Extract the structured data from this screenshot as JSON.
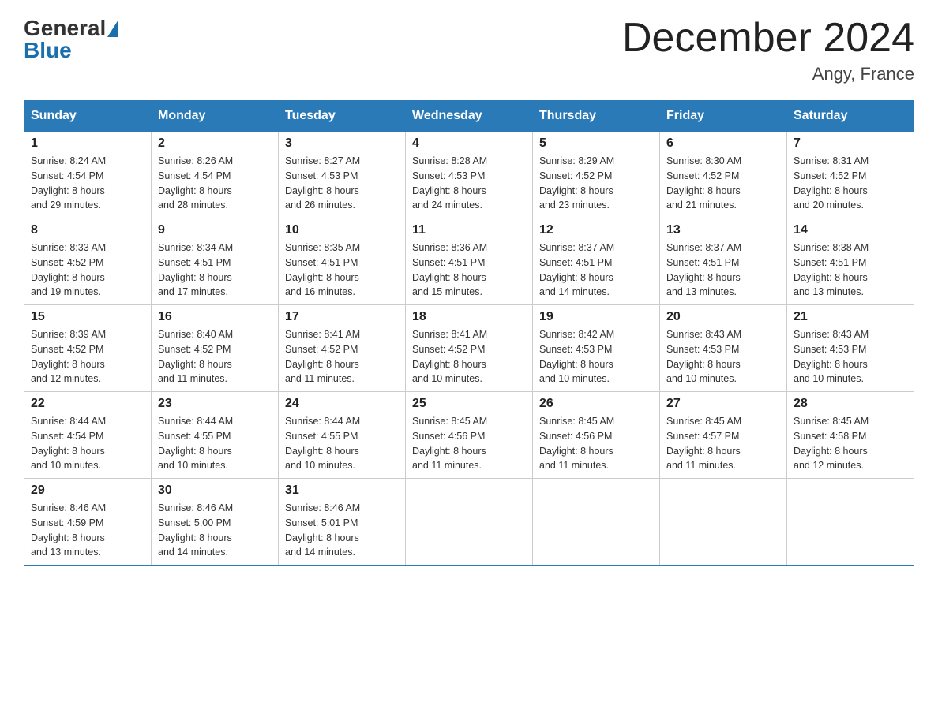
{
  "header": {
    "logo_general": "General",
    "logo_blue": "Blue",
    "month_title": "December 2024",
    "location": "Angy, France"
  },
  "days_of_week": [
    "Sunday",
    "Monday",
    "Tuesday",
    "Wednesday",
    "Thursday",
    "Friday",
    "Saturday"
  ],
  "weeks": [
    [
      {
        "day": "1",
        "sunrise": "Sunrise: 8:24 AM",
        "sunset": "Sunset: 4:54 PM",
        "daylight": "Daylight: 8 hours",
        "daylight2": "and 29 minutes."
      },
      {
        "day": "2",
        "sunrise": "Sunrise: 8:26 AM",
        "sunset": "Sunset: 4:54 PM",
        "daylight": "Daylight: 8 hours",
        "daylight2": "and 28 minutes."
      },
      {
        "day": "3",
        "sunrise": "Sunrise: 8:27 AM",
        "sunset": "Sunset: 4:53 PM",
        "daylight": "Daylight: 8 hours",
        "daylight2": "and 26 minutes."
      },
      {
        "day": "4",
        "sunrise": "Sunrise: 8:28 AM",
        "sunset": "Sunset: 4:53 PM",
        "daylight": "Daylight: 8 hours",
        "daylight2": "and 24 minutes."
      },
      {
        "day": "5",
        "sunrise": "Sunrise: 8:29 AM",
        "sunset": "Sunset: 4:52 PM",
        "daylight": "Daylight: 8 hours",
        "daylight2": "and 23 minutes."
      },
      {
        "day": "6",
        "sunrise": "Sunrise: 8:30 AM",
        "sunset": "Sunset: 4:52 PM",
        "daylight": "Daylight: 8 hours",
        "daylight2": "and 21 minutes."
      },
      {
        "day": "7",
        "sunrise": "Sunrise: 8:31 AM",
        "sunset": "Sunset: 4:52 PM",
        "daylight": "Daylight: 8 hours",
        "daylight2": "and 20 minutes."
      }
    ],
    [
      {
        "day": "8",
        "sunrise": "Sunrise: 8:33 AM",
        "sunset": "Sunset: 4:52 PM",
        "daylight": "Daylight: 8 hours",
        "daylight2": "and 19 minutes."
      },
      {
        "day": "9",
        "sunrise": "Sunrise: 8:34 AM",
        "sunset": "Sunset: 4:51 PM",
        "daylight": "Daylight: 8 hours",
        "daylight2": "and 17 minutes."
      },
      {
        "day": "10",
        "sunrise": "Sunrise: 8:35 AM",
        "sunset": "Sunset: 4:51 PM",
        "daylight": "Daylight: 8 hours",
        "daylight2": "and 16 minutes."
      },
      {
        "day": "11",
        "sunrise": "Sunrise: 8:36 AM",
        "sunset": "Sunset: 4:51 PM",
        "daylight": "Daylight: 8 hours",
        "daylight2": "and 15 minutes."
      },
      {
        "day": "12",
        "sunrise": "Sunrise: 8:37 AM",
        "sunset": "Sunset: 4:51 PM",
        "daylight": "Daylight: 8 hours",
        "daylight2": "and 14 minutes."
      },
      {
        "day": "13",
        "sunrise": "Sunrise: 8:37 AM",
        "sunset": "Sunset: 4:51 PM",
        "daylight": "Daylight: 8 hours",
        "daylight2": "and 13 minutes."
      },
      {
        "day": "14",
        "sunrise": "Sunrise: 8:38 AM",
        "sunset": "Sunset: 4:51 PM",
        "daylight": "Daylight: 8 hours",
        "daylight2": "and 13 minutes."
      }
    ],
    [
      {
        "day": "15",
        "sunrise": "Sunrise: 8:39 AM",
        "sunset": "Sunset: 4:52 PM",
        "daylight": "Daylight: 8 hours",
        "daylight2": "and 12 minutes."
      },
      {
        "day": "16",
        "sunrise": "Sunrise: 8:40 AM",
        "sunset": "Sunset: 4:52 PM",
        "daylight": "Daylight: 8 hours",
        "daylight2": "and 11 minutes."
      },
      {
        "day": "17",
        "sunrise": "Sunrise: 8:41 AM",
        "sunset": "Sunset: 4:52 PM",
        "daylight": "Daylight: 8 hours",
        "daylight2": "and 11 minutes."
      },
      {
        "day": "18",
        "sunrise": "Sunrise: 8:41 AM",
        "sunset": "Sunset: 4:52 PM",
        "daylight": "Daylight: 8 hours",
        "daylight2": "and 10 minutes."
      },
      {
        "day": "19",
        "sunrise": "Sunrise: 8:42 AM",
        "sunset": "Sunset: 4:53 PM",
        "daylight": "Daylight: 8 hours",
        "daylight2": "and 10 minutes."
      },
      {
        "day": "20",
        "sunrise": "Sunrise: 8:43 AM",
        "sunset": "Sunset: 4:53 PM",
        "daylight": "Daylight: 8 hours",
        "daylight2": "and 10 minutes."
      },
      {
        "day": "21",
        "sunrise": "Sunrise: 8:43 AM",
        "sunset": "Sunset: 4:53 PM",
        "daylight": "Daylight: 8 hours",
        "daylight2": "and 10 minutes."
      }
    ],
    [
      {
        "day": "22",
        "sunrise": "Sunrise: 8:44 AM",
        "sunset": "Sunset: 4:54 PM",
        "daylight": "Daylight: 8 hours",
        "daylight2": "and 10 minutes."
      },
      {
        "day": "23",
        "sunrise": "Sunrise: 8:44 AM",
        "sunset": "Sunset: 4:55 PM",
        "daylight": "Daylight: 8 hours",
        "daylight2": "and 10 minutes."
      },
      {
        "day": "24",
        "sunrise": "Sunrise: 8:44 AM",
        "sunset": "Sunset: 4:55 PM",
        "daylight": "Daylight: 8 hours",
        "daylight2": "and 10 minutes."
      },
      {
        "day": "25",
        "sunrise": "Sunrise: 8:45 AM",
        "sunset": "Sunset: 4:56 PM",
        "daylight": "Daylight: 8 hours",
        "daylight2": "and 11 minutes."
      },
      {
        "day": "26",
        "sunrise": "Sunrise: 8:45 AM",
        "sunset": "Sunset: 4:56 PM",
        "daylight": "Daylight: 8 hours",
        "daylight2": "and 11 minutes."
      },
      {
        "day": "27",
        "sunrise": "Sunrise: 8:45 AM",
        "sunset": "Sunset: 4:57 PM",
        "daylight": "Daylight: 8 hours",
        "daylight2": "and 11 minutes."
      },
      {
        "day": "28",
        "sunrise": "Sunrise: 8:45 AM",
        "sunset": "Sunset: 4:58 PM",
        "daylight": "Daylight: 8 hours",
        "daylight2": "and 12 minutes."
      }
    ],
    [
      {
        "day": "29",
        "sunrise": "Sunrise: 8:46 AM",
        "sunset": "Sunset: 4:59 PM",
        "daylight": "Daylight: 8 hours",
        "daylight2": "and 13 minutes."
      },
      {
        "day": "30",
        "sunrise": "Sunrise: 8:46 AM",
        "sunset": "Sunset: 5:00 PM",
        "daylight": "Daylight: 8 hours",
        "daylight2": "and 14 minutes."
      },
      {
        "day": "31",
        "sunrise": "Sunrise: 8:46 AM",
        "sunset": "Sunset: 5:01 PM",
        "daylight": "Daylight: 8 hours",
        "daylight2": "and 14 minutes."
      },
      {
        "day": "",
        "sunrise": "",
        "sunset": "",
        "daylight": "",
        "daylight2": ""
      },
      {
        "day": "",
        "sunrise": "",
        "sunset": "",
        "daylight": "",
        "daylight2": ""
      },
      {
        "day": "",
        "sunrise": "",
        "sunset": "",
        "daylight": "",
        "daylight2": ""
      },
      {
        "day": "",
        "sunrise": "",
        "sunset": "",
        "daylight": "",
        "daylight2": ""
      }
    ]
  ]
}
